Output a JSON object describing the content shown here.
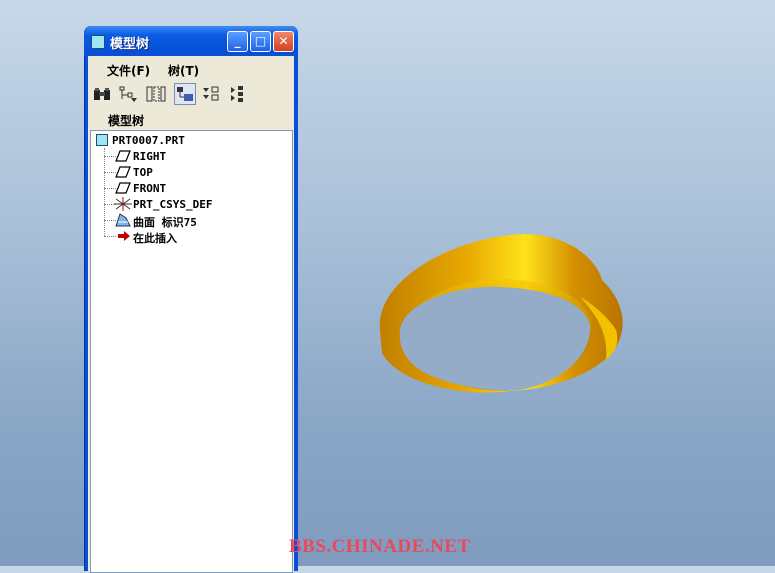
{
  "window": {
    "title": "模型树",
    "minimize": "_",
    "maximize": "□",
    "close": "✕"
  },
  "menu": {
    "file": "文件(F)",
    "tree": "树(T)"
  },
  "toolbar": {
    "icons": [
      "binoculars-icon",
      "tree-filter-icon",
      "columns-icon",
      "display-mode-icon",
      "expand-icon",
      "collapse-icon"
    ]
  },
  "panel": {
    "label": "模型树"
  },
  "tree": {
    "root": "PRT0007.PRT",
    "items": [
      {
        "label": "RIGHT",
        "icon": "datum-plane-icon"
      },
      {
        "label": "TOP",
        "icon": "datum-plane-icon"
      },
      {
        "label": "FRONT",
        "icon": "datum-plane-icon"
      },
      {
        "label": "PRT_CSYS_DEF",
        "icon": "coordinate-system-icon"
      },
      {
        "label": "曲面 标识75",
        "icon": "surface-feature-icon"
      },
      {
        "label": "在此插入",
        "icon": "insert-here-arrow-icon"
      }
    ]
  },
  "watermark": "BBS.CHINADE.NET",
  "colors": {
    "surface": "#d89a00",
    "titlebar": "#0a4fd6",
    "watermark": "#e84a5c"
  }
}
